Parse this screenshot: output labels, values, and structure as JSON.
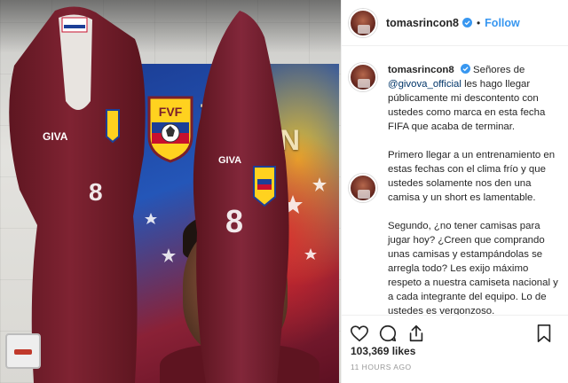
{
  "post": {
    "username": "tomasrincon8",
    "follow_label": "Follow",
    "separator": "•",
    "caption": {
      "username": "tomasrincon8",
      "lead": " Señores de ",
      "mention": "@givova_official",
      "p1_rest": " les hago llegar públicamente mi descontento con ustedes como marca en esta fecha FIFA que acaba de terminar.",
      "p2": "Primero llegar a un entrenamiento en estas fechas con el clima frío y que ustedes solamente nos den una camisa y un short es lamentable.",
      "p3": "Segundo, ¿no tener camisas para jugar hoy? ¿Creen que comprando unas camisas y estampándolas se arregla todo? Les exijo máximo respeto a nuestra camiseta nacional y a cada integrante del equipo. Lo de ustedes es vergonzoso."
    },
    "caption_time": "11h",
    "likes": "103,369 likes",
    "time_ago": "11 HOURS AGO"
  },
  "photo": {
    "crest_text": "FVF",
    "banner_letters_1": "T",
    "banner_letters_2": "ON",
    "shirt_brand": "GIVA",
    "shirt_number": "8"
  },
  "icons": {
    "like": "heart-icon",
    "comment": "comment-icon",
    "share": "share-icon",
    "save": "bookmark-icon",
    "verified": "verified-badge-icon"
  },
  "colors": {
    "link": "#3897f0",
    "mention": "#003569",
    "verified": "#3897f0",
    "jersey": "#7a1f2b",
    "muted": "#999999"
  }
}
